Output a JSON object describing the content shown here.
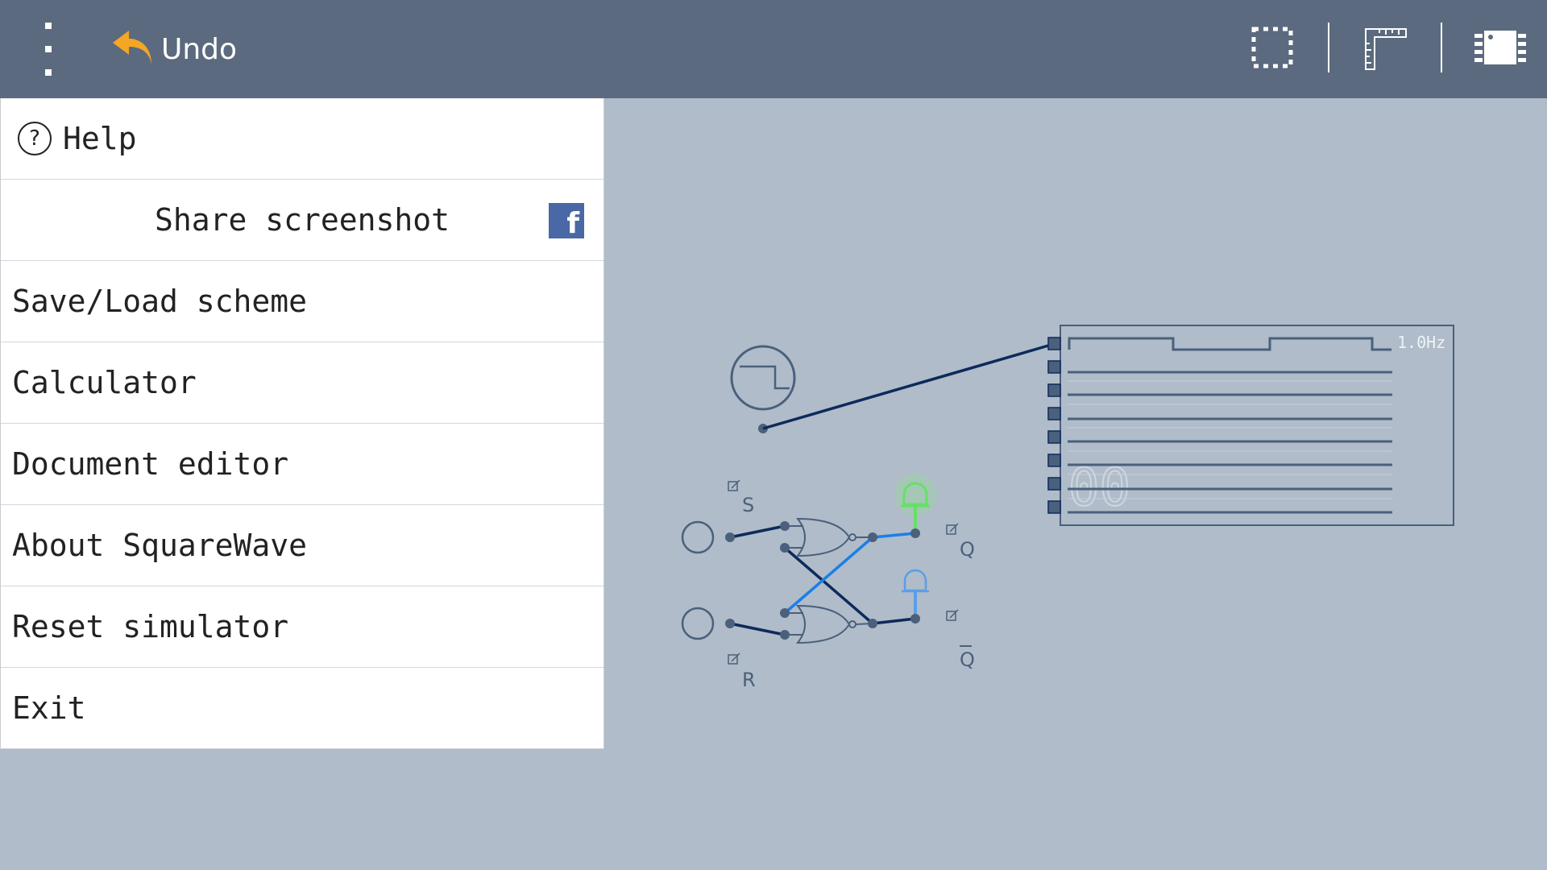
{
  "toolbar": {
    "menu_icon": "more-vert-icon",
    "undo_label": "Undo",
    "undo_icon": "undo-arrow-icon",
    "undo_color": "#f5a623",
    "right_icons": [
      "selection-icon",
      "ruler-icon",
      "chip-icon"
    ]
  },
  "menu": {
    "items": [
      {
        "label": "Help",
        "icon": "help-icon"
      },
      {
        "label": "Share screenshot",
        "icon": "facebook-icon"
      },
      {
        "label": "Save/Load scheme"
      },
      {
        "label": "Calculator"
      },
      {
        "label": "Document editor"
      },
      {
        "label": "About SquareWave"
      },
      {
        "label": "Reset simulator"
      },
      {
        "label": "Exit"
      }
    ],
    "help_glyph": "?",
    "facebook_glyph": "f"
  },
  "circuit": {
    "oscilloscope_freq": "1.0Hz",
    "display_digits": "00",
    "label_s": "S",
    "label_r": "R",
    "label_q": "Q",
    "label_qbar": "Q",
    "colors": {
      "wire": "#0d2a5c",
      "active_wire": "#1a7fe8",
      "led_on": "#66e066",
      "led_off": "#5a9ee8",
      "component": "#4a607c"
    }
  }
}
